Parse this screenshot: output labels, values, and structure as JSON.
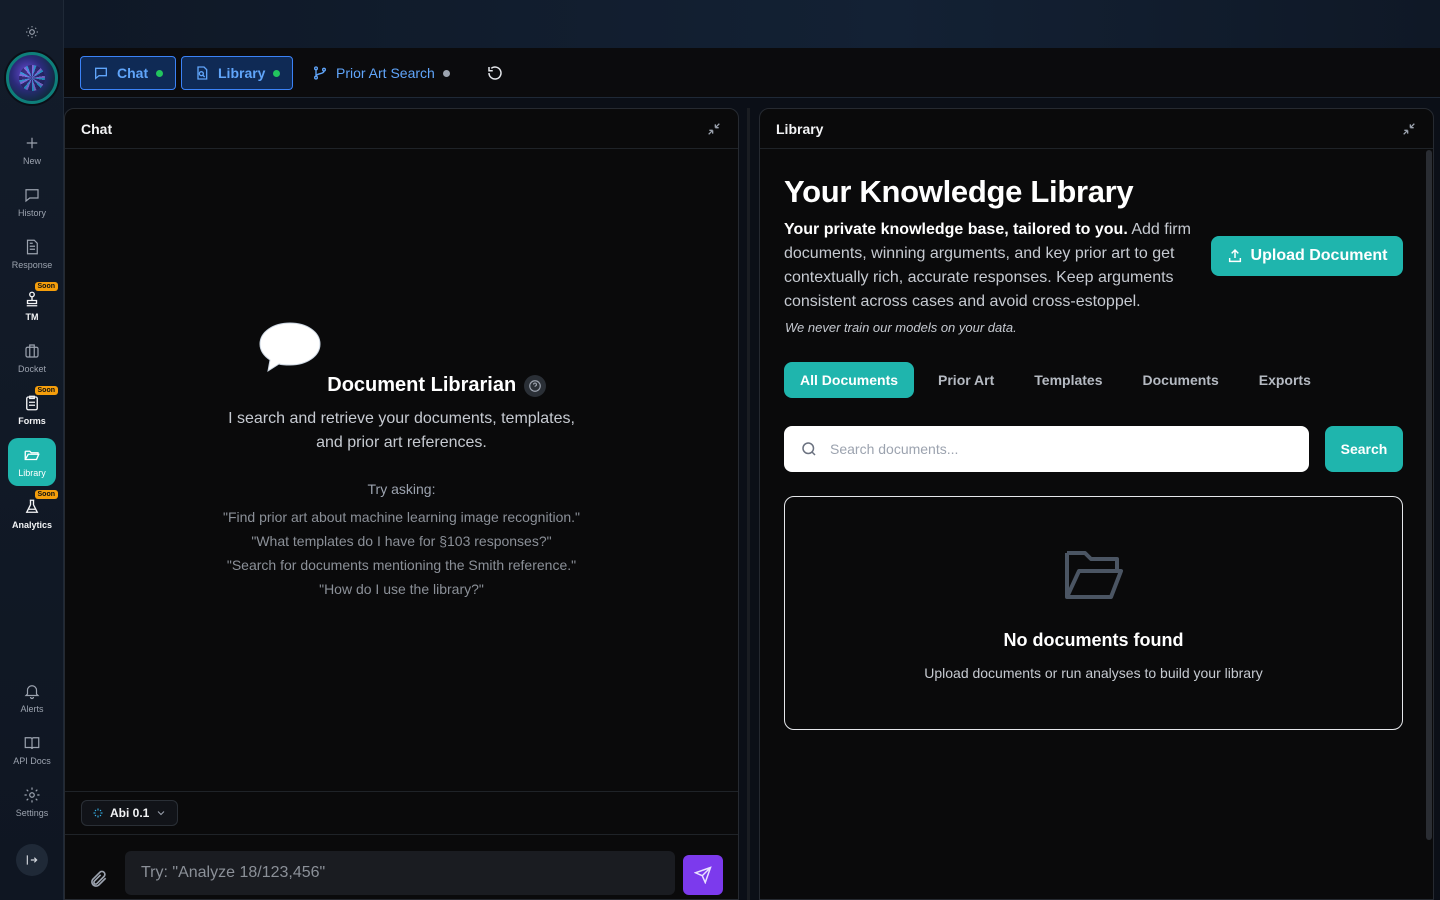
{
  "sidebar": {
    "items": [
      {
        "id": "new",
        "label": "New",
        "icon": "plus-icon"
      },
      {
        "id": "history",
        "label": "History",
        "icon": "chat-icon"
      },
      {
        "id": "response",
        "label": "Response",
        "icon": "document-icon"
      },
      {
        "id": "tm",
        "label": "TM",
        "icon": "stamp-icon",
        "badge": "Soon"
      },
      {
        "id": "docket",
        "label": "Docket",
        "icon": "briefcase-icon"
      },
      {
        "id": "forms",
        "label": "Forms",
        "icon": "clipboard-icon",
        "badge": "Soon"
      },
      {
        "id": "library",
        "label": "Library",
        "icon": "folder-open-icon",
        "active": true
      },
      {
        "id": "analytics",
        "label": "Analytics",
        "icon": "flask-icon",
        "badge": "Soon"
      },
      {
        "id": "alerts",
        "label": "Alerts",
        "icon": "bell-icon"
      },
      {
        "id": "api_docs",
        "label": "API Docs",
        "icon": "book-icon"
      },
      {
        "id": "settings",
        "label": "Settings",
        "icon": "gear-icon"
      }
    ]
  },
  "toolbar": {
    "tabs": [
      {
        "label": "Chat",
        "status": "active"
      },
      {
        "label": "Library",
        "status": "active"
      },
      {
        "label": "Prior Art Search",
        "status": "inactive"
      }
    ]
  },
  "chat": {
    "title": "Chat",
    "assistant_name": "Document Librarian",
    "subtitle_line1": "I search and retrieve your documents, templates,",
    "subtitle_line2": "and prior art references.",
    "try_label": "Try asking:",
    "examples": [
      "\"Find prior art about machine learning image recognition.\"",
      "\"What templates do I have for §103 responses?\"",
      "\"Search for documents mentioning the Smith reference.\"",
      "\"How do I use the library?\""
    ],
    "model_label": "Abi 0.1",
    "input_placeholder": "Try: \"Analyze 18/123,456\""
  },
  "library": {
    "title": "Library",
    "heading": "Your Knowledge Library",
    "desc_bold": "Your private knowledge base, tailored to you.",
    "desc_rest": " Add firm documents, winning arguments, and key prior art to get contextually rich, accurate responses. Keep arguments consistent across cases and avoid cross-estoppel.",
    "note": "We never train our models on your data.",
    "upload_label": "Upload Document",
    "filters": [
      "All Documents",
      "Prior Art",
      "Templates",
      "Documents",
      "Exports"
    ],
    "active_filter": "All Documents",
    "search_placeholder": "Search documents...",
    "search_button": "Search",
    "empty_title": "No documents found",
    "empty_subtitle": "Upload documents or run analyses to build your library"
  },
  "colors": {
    "accent": "#1fb5ad",
    "tab_blue": "#60a5fa",
    "status_green": "#22c55e",
    "send_purple": "#7c3aed",
    "soon_badge": "#f59e0b"
  }
}
